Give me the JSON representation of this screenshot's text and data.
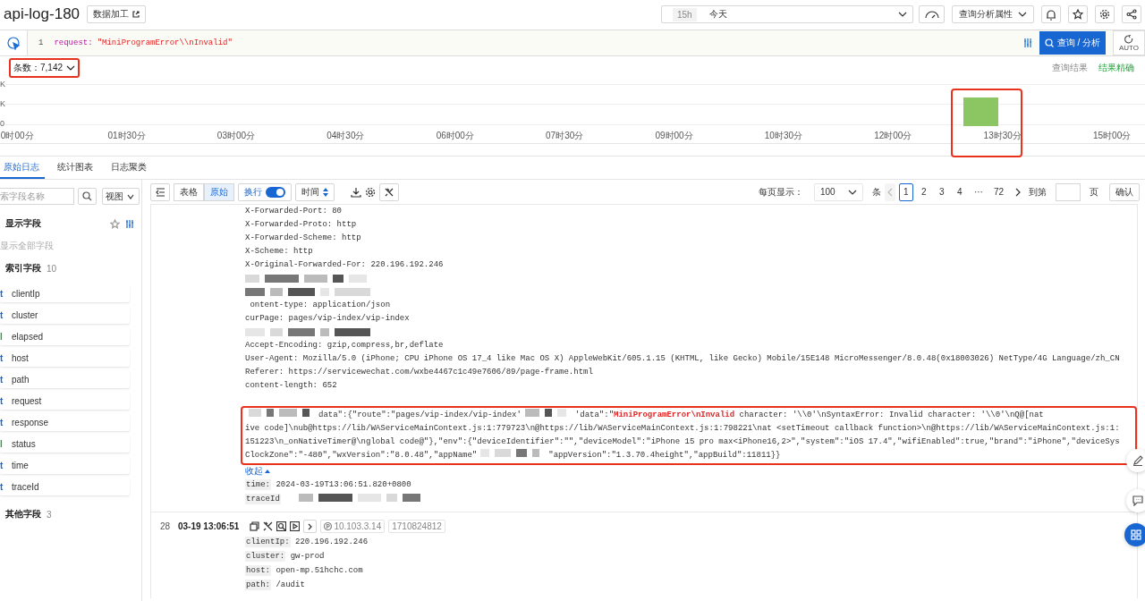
{
  "header": {
    "title": "api-log-180",
    "process_button": "数据加工",
    "time_range": {
      "badge": "15h",
      "value": "今天"
    },
    "attributes_button": "查询分析属性"
  },
  "query": {
    "line_number": "1",
    "key": "request",
    "separator": ":",
    "value": "\"MiniProgramError\\\\nInvalid\"",
    "search_button": "查询 / 分析",
    "auto_label": "AUTO"
  },
  "histogram": {
    "count_label": "条数：7,142",
    "count_highlighted": true,
    "result_label": "查询结果",
    "accuracy_label": "结果精确",
    "y_labels": [
      "K",
      "K",
      "0"
    ],
    "bar_highlighted": true,
    "x_labels": [
      "0时00分",
      "01时30分",
      "03时00分",
      "04时30分",
      "06时00分",
      "07时30分",
      "09时00分",
      "10时30分",
      "12时00分",
      "13时30分",
      "15时00分"
    ]
  },
  "tabs": [
    {
      "label": "原始日志",
      "selected": true
    },
    {
      "label": "统计图表",
      "selected": false
    },
    {
      "label": "日志聚类",
      "selected": false
    }
  ],
  "sidebar": {
    "search_placeholder": "索字段名称",
    "view_select": "视图",
    "display_title": "显示字段",
    "show_all": "显示全部字段",
    "index_title": "索引字段",
    "index_count": "10",
    "fields": [
      {
        "kind": "text",
        "type": "t",
        "name": "clientIp"
      },
      {
        "kind": "text",
        "type": "t",
        "name": "cluster"
      },
      {
        "kind": "long",
        "type": "l",
        "name": "elapsed"
      },
      {
        "kind": "text",
        "type": "t",
        "name": "host"
      },
      {
        "kind": "text",
        "type": "t",
        "name": "path"
      },
      {
        "kind": "text",
        "type": "t",
        "name": "request"
      },
      {
        "kind": "text",
        "type": "t",
        "name": "response"
      },
      {
        "kind": "long",
        "type": "l",
        "name": "status"
      },
      {
        "kind": "text",
        "type": "t",
        "name": "time"
      },
      {
        "kind": "text",
        "type": "t",
        "name": "traceId"
      }
    ],
    "other_title": "其他字段",
    "other_count": "3"
  },
  "toolbar": {
    "view_modes": [
      {
        "label": "表格",
        "selected": false
      },
      {
        "label": "原始",
        "selected": true
      }
    ],
    "wrap_label": "换行",
    "wrap_on": true,
    "sort_label": "时间"
  },
  "pagination": {
    "page_size_label": "每页显示：",
    "page_size": "100",
    "unit": "条",
    "pages": [
      {
        "label": "1",
        "selected": true
      },
      {
        "label": "2",
        "selected": false
      },
      {
        "label": "3",
        "selected": false
      },
      {
        "label": "4",
        "selected": false
      },
      {
        "label": "···",
        "selected": false
      },
      {
        "label": "72",
        "selected": false
      }
    ],
    "goto_label": "到第",
    "page_unit": "页",
    "confirm_button": "确认"
  },
  "log": {
    "lines": [
      {
        "kind": "text",
        "text": "X-Forwarded-Port: 80"
      },
      {
        "kind": "text",
        "text": "X-Forwarded-Proto: http"
      },
      {
        "kind": "text",
        "text": "X-Forwarded-Scheme: http"
      },
      {
        "kind": "text",
        "text": "X-Scheme: http"
      },
      {
        "kind": "text",
        "text": "X-Original-Forwarded-For: 220.196.192.246"
      },
      {
        "kind": "redacted"
      },
      {
        "kind": "redacted"
      },
      {
        "kind": "text",
        "text": " ontent-type: application/json"
      },
      {
        "kind": "text",
        "text": "curPage: pages/vip-index/vip-index"
      },
      {
        "kind": "redacted"
      },
      {
        "kind": "text",
        "text": "Accept-Encoding: gzip,compress,br,deflate"
      },
      {
        "kind": "text",
        "text": "User-Agent: Mozilla/5.0 (iPhone; CPU iPhone OS 17_4 like Mac OS X) AppleWebKit/605.1.15 (KHTML, like Gecko) Mobile/15E148 MicroMessenger/8.0.48(0x18003026) NetType/4G Language/zh_CN"
      },
      {
        "kind": "text",
        "text": "Referer: https://servicewechat.com/wxbe4467c1c49e7606/89/page-frame.html"
      },
      {
        "kind": "text",
        "text": "content-length: 652"
      }
    ],
    "highlighted": true,
    "highlight_lines": [
      [
        {
          "kind": "redacted"
        },
        {
          "kind": "text",
          "text": "data\":{\"route\":\"pages/vip-index/vip-index'"
        },
        {
          "kind": "redacted"
        },
        {
          "kind": "text",
          "text": "'data\":\"**MiniProgramError\\nInvalid** character: '\\\\0'\\nSyntaxError: Invalid character: '\\\\0'\\nQ@[nat"
        }
      ],
      [
        {
          "kind": "text",
          "text": "ive code]\\nub@https://lib/WAServiceMainContext.js:1:779723\\n@https://lib/WAServiceMainContext.js:1:798221\\nat <setTimeout callback function>\\n@https://lib/WAServiceMainContext.js:1:"
        }
      ],
      [
        {
          "kind": "text",
          "text": "151223\\n_onNativeTimer@\\nglobal code@\"},\"env\":{\"deviceIdentifier\":\"\",\"deviceModel\":\"iPhone 15 pro max<iPhone16,2>\",\"system\":\"iOS 17.4\",\"wifiEnabled\":true,\"brand\":\"iPhone\",\"deviceSys"
        }
      ],
      [
        {
          "kind": "text",
          "text": "ClockZone\":\"-480\",\"wxVersion\":\"8.0.48\",\"appName\""
        },
        {
          "kind": "redacted"
        },
        {
          "kind": "text",
          "text": "\"appVersion\":\"1.3.70.4height\",\"appBuild\":11811}}"
        }
      ]
    ],
    "collapse_link": "收起",
    "fields": [
      {
        "key": "time:",
        "value": "2024-03-19T13:06:51.820+0800"
      },
      {
        "key": "traceId",
        "redacted": true
      }
    ]
  },
  "entry": {
    "index": "28",
    "time": "03-19 13:06:51",
    "ip": "10.103.3.14",
    "tag": "1710824812",
    "fields": [
      {
        "key": "clientIp:",
        "value": "220.196.192.246"
      },
      {
        "key": "cluster:",
        "value": "gw-prod"
      },
      {
        "key": "host:",
        "value": "open-mp.51hchc.com"
      },
      {
        "key": "path:",
        "value": "/audit"
      }
    ]
  }
}
